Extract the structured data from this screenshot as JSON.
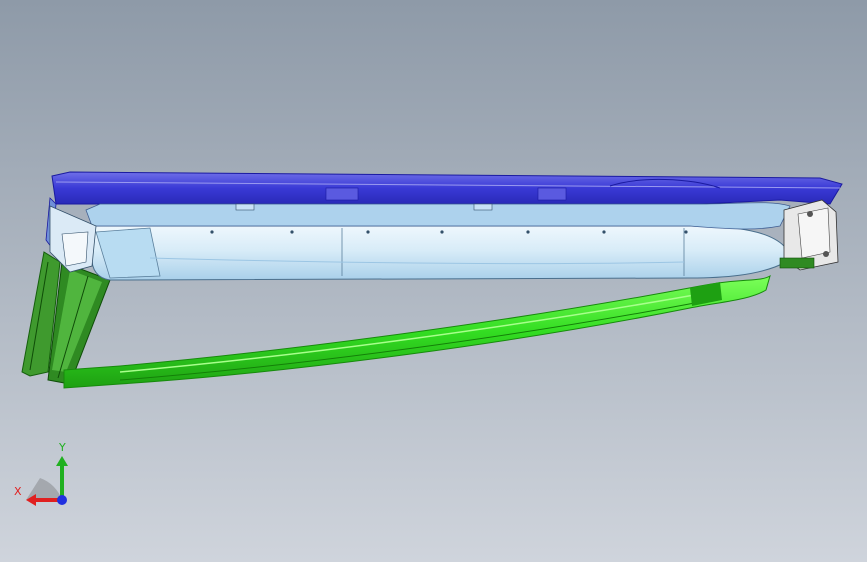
{
  "viewport": {
    "background_top": "#8e9aa8",
    "background_bottom": "#cfd4dc",
    "model_colors": {
      "top_cover": "#3a3ad6",
      "top_cover_edge": "#1a1aa0",
      "tray_body": "#d8ecf8",
      "tray_shadow": "#9cc6e4",
      "frame_rail": "#33dd22",
      "frame_rail_dark": "#1e8a12",
      "hinge_arm": "#2f8a22",
      "bracket": "#e8e8e8"
    }
  },
  "triad": {
    "x_label": "X",
    "y_label": "Y",
    "x_color": "#e02020",
    "y_color": "#20b020",
    "z_color": "#2030e0"
  }
}
